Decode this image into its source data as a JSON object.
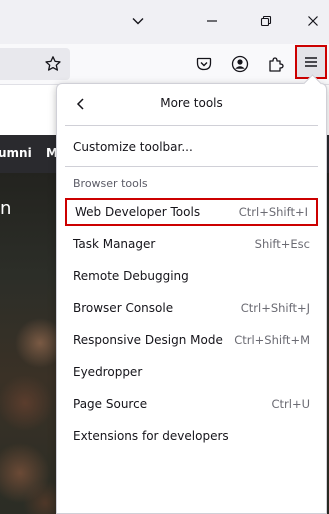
{
  "menu": {
    "title": "More tools",
    "customize": "Customize toolbar...",
    "section_label": "Browser tools",
    "items": [
      {
        "label": "Web Developer Tools",
        "shortcut": "Ctrl+Shift+I"
      },
      {
        "label": "Task Manager",
        "shortcut": "Shift+Esc"
      },
      {
        "label": "Remote Debugging",
        "shortcut": ""
      },
      {
        "label": "Browser Console",
        "shortcut": "Ctrl+Shift+J"
      },
      {
        "label": "Responsive Design Mode",
        "shortcut": "Ctrl+Shift+M"
      },
      {
        "label": "Eyedropper",
        "shortcut": ""
      },
      {
        "label": "Page Source",
        "shortcut": "Ctrl+U"
      },
      {
        "label": "Extensions for developers",
        "shortcut": ""
      }
    ]
  },
  "page": {
    "nav_items": [
      "umni",
      "M"
    ],
    "hero_text": "n"
  },
  "colors": {
    "highlight": "#cc0000",
    "accent": "#15141a"
  }
}
